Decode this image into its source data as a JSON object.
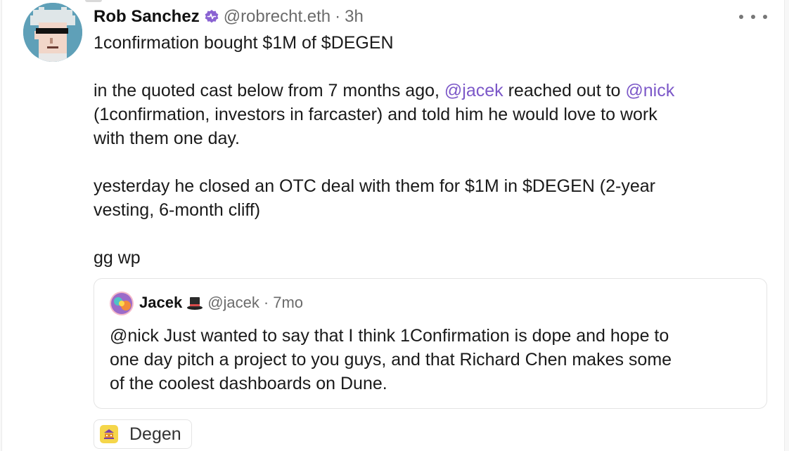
{
  "post": {
    "author_name": "Rob Sanchez",
    "handle": "@robrecht.eth",
    "separator": "·",
    "time": "3h",
    "lines": [
      [
        {
          "t": "1confirmation bought $1M of $DEGEN"
        }
      ],
      [],
      [
        {
          "t": "in the quoted cast below from 7 months ago, "
        },
        {
          "t": "@jacek",
          "m": true
        },
        {
          "t": " reached out to "
        },
        {
          "t": "@nick",
          "m": true
        }
      ],
      [
        {
          "t": "(1confirmation, investors in farcaster) and told him he would love to work"
        }
      ],
      [
        {
          "t": "with them one day."
        }
      ],
      [],
      [
        {
          "t": "yesterday he closed an OTC deal with them for $1M in $DEGEN (2-year"
        }
      ],
      [
        {
          "t": "vesting, 6-month cliff)"
        }
      ],
      [],
      [
        {
          "t": "gg wp"
        }
      ]
    ]
  },
  "quote": {
    "author_name": "Jacek",
    "handle": "@jacek",
    "separator": "·",
    "time": "7mo",
    "lines": [
      "@nick Just wanted to say that I think 1Confirmation is dope and hope to",
      "one day pitch a project to you guys, and that Richard Chen makes some",
      "of the coolest dashboards on Dune."
    ]
  },
  "channel": {
    "label": "Degen"
  },
  "icons": {
    "verified": "verified-badge-icon",
    "more": "more-options-icon",
    "tophat": "top-hat-icon",
    "channel": "degen-channel-icon"
  },
  "colors": {
    "mention": "#7c58c8",
    "verified": "#8a63d2",
    "channel_icon_bg": "#f5d64a"
  }
}
